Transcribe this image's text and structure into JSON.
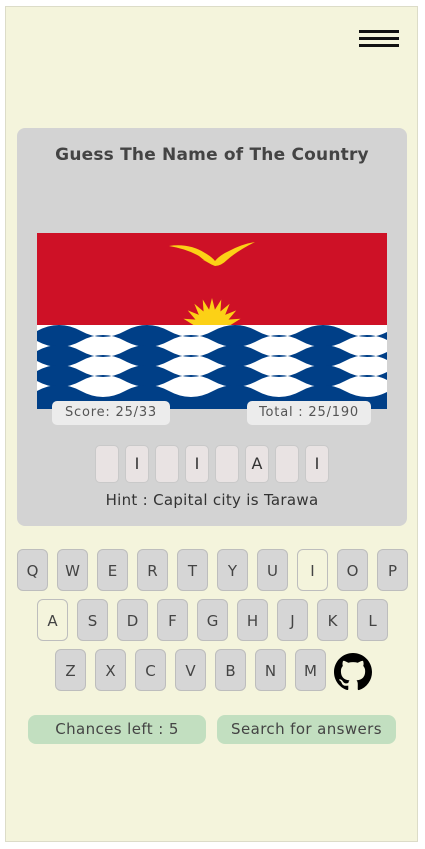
{
  "header": {
    "menu_icon": "hamburger-menu-icon"
  },
  "card": {
    "title": "Guess The Name of The Country",
    "flag_icon": "kiribati-flag",
    "score": "Score: 25/33",
    "total": "Total : 25/190",
    "answer_slots": [
      "",
      "I",
      "",
      "I",
      "",
      "A",
      "",
      "I"
    ],
    "hint": "Hint : Capital city is Tarawa"
  },
  "keyboard": {
    "rows": [
      [
        "Q",
        "W",
        "E",
        "R",
        "T",
        "Y",
        "U",
        "I",
        "O",
        "P"
      ],
      [
        "A",
        "S",
        "D",
        "F",
        "G",
        "H",
        "J",
        "K",
        "L"
      ],
      [
        "Z",
        "X",
        "C",
        "V",
        "B",
        "N",
        "M"
      ]
    ],
    "used_keys": [
      "I",
      "A"
    ],
    "github_icon": "github-icon"
  },
  "footer": {
    "chances": "Chances left : 5",
    "search": "Search for answers"
  },
  "colors": {
    "background": "#f4f4dc",
    "card": "#d3d3d3",
    "key": "#d6d6d6",
    "pill": "#c2dfc0",
    "flag_red": "#ce1126",
    "flag_blue": "#003f87",
    "flag_gold": "#fcd116"
  }
}
